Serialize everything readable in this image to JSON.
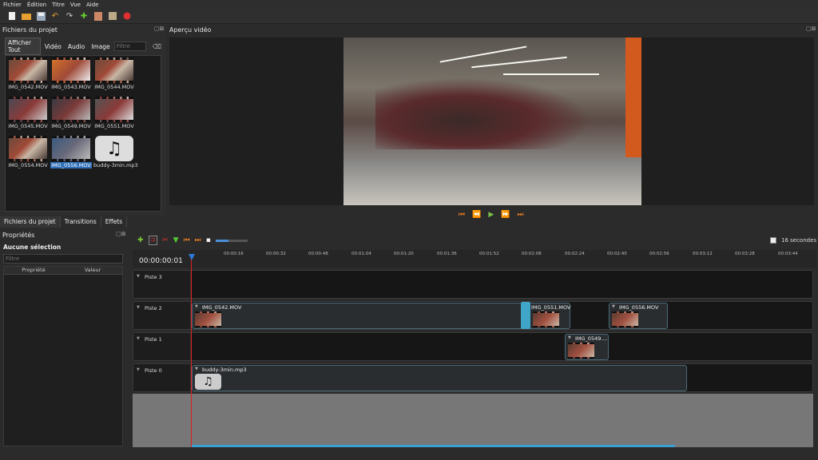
{
  "menu": [
    "Fichier",
    "Édition",
    "Titre",
    "Vue",
    "Aide"
  ],
  "toolbar": {
    "icons": [
      "new-project-icon",
      "open-project-icon",
      "save-project-icon",
      "undo-icon",
      "redo-icon",
      "import-files-icon",
      "choose-profile-icon",
      "fullscreen-icon",
      "export-video-icon"
    ]
  },
  "files_panel": {
    "title": "Fichiers du projet",
    "dock": "▢⊠",
    "filters": [
      "Afficher Tout",
      "Vidéo",
      "Audio",
      "Image"
    ],
    "filter_placeholder": "Filtre",
    "items": [
      {
        "label": "IMG_0542.MOV",
        "type": "video"
      },
      {
        "label": "IMG_0543.MOV",
        "type": "video"
      },
      {
        "label": "IMG_0544.MOV",
        "type": "video"
      },
      {
        "label": "IMG_0545.MOV",
        "type": "video"
      },
      {
        "label": "IMG_0549.MOV",
        "type": "video"
      },
      {
        "label": "IMG_0551.MOV",
        "type": "video"
      },
      {
        "label": "IMG_0554.MOV",
        "type": "video"
      },
      {
        "label": "IMG_0556.MOV",
        "type": "video",
        "selected": true
      },
      {
        "label": "buddy-3min.mp3",
        "type": "audio"
      }
    ]
  },
  "bottom_tabs": [
    "Fichiers du projet",
    "Transitions",
    "Effets"
  ],
  "properties": {
    "title": "Propriétés",
    "selection": "Aucune sélection",
    "filter_placeholder": "Filtre",
    "columns": [
      "Propriété",
      "Valeur"
    ]
  },
  "preview": {
    "title": "Aperçu vidéo",
    "controls": [
      "⏮",
      "⏪",
      "▶",
      "⏩",
      "⏭"
    ]
  },
  "timeline": {
    "timecode": "00:00:00:01",
    "duration_label": "16 secondes",
    "ticks": [
      "00:00:16",
      "00:00:32",
      "00:00:48",
      "00:01:04",
      "00:01:20",
      "00:01:36",
      "00:01:52",
      "00:02:08",
      "00:02:24",
      "00:02:40",
      "00:02:56",
      "00:03:12",
      "00:03:28",
      "00:03:44"
    ],
    "tracks": [
      {
        "name": "Piste 3",
        "clips": []
      },
      {
        "name": "Piste 2",
        "clips": [
          "IMG_0542.MOV",
          "IMG_0551.MOV",
          "IMG_0556.MOV"
        ]
      },
      {
        "name": "Piste 1",
        "clips": [
          "IMG_0549...."
        ]
      },
      {
        "name": "Piste 0",
        "clips": [
          "buddy-3min.mp3"
        ]
      }
    ]
  },
  "colors": {
    "accent": "#2f6fb8",
    "playhead": "#e02020",
    "transport": "#e07a20",
    "play": "#7cc04a"
  }
}
